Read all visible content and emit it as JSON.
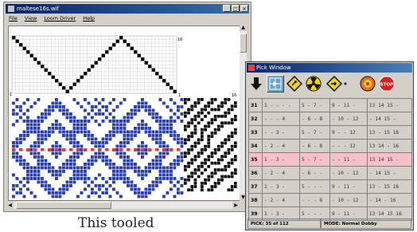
{
  "main_window": {
    "title": "maltese16s.wif",
    "menu": [
      "File",
      "View",
      "Loom Driver",
      "Help"
    ],
    "buttons": {
      "minimize": "_",
      "maximize": "□",
      "close": "×"
    },
    "ticks": {
      "top_right": "16",
      "top_left_mid": "1",
      "row_1": "1",
      "right_16": "16",
      "bottom": "1"
    }
  },
  "pick_window": {
    "title": "Pick Window",
    "tools": [
      "down-arrow-icon",
      "pick-grid-icon",
      "yield-sign-icon",
      "radiation-icon",
      "diamond-pick-icon",
      "bullseye-icon",
      "stop-sign-icon"
    ],
    "stop_label": "STOP",
    "rows": [
      {
        "num": "31",
        "c1": "1 - - - -",
        "c2": "5 - 7 -",
        "c3": "9 - 11 -",
        "c4": "13 14 15 -"
      },
      {
        "num": "32",
        "c1": "- - - 4",
        "c2": "- 6 - 8",
        "c3": "- 10 - 12",
        "c4": "- 14 15 -"
      },
      {
        "num": "33",
        "c1": "- - 3 -",
        "c2": "5 - 7 -",
        "c3": "9 - - 12",
        "c4": "13 - 15 16"
      },
      {
        "num": "34",
        "c1": "- 2 - 4",
        "c2": "- 6 - 8",
        "c3": "- - - 12",
        "c4": "13 14 - 16"
      },
      {
        "num": "35",
        "c1": "1 - 3 -",
        "c2": "5 - 7 -",
        "c3": "- - 11 -",
        "c4": "13 14 15 -"
      },
      {
        "num": "36",
        "c1": "- 2 - 4",
        "c2": "- 6 - -",
        "c3": "- 10 - 12",
        "c4": "- 14 15 -"
      },
      {
        "num": "37",
        "c1": "1 - 3 -",
        "c2": "5 - - -",
        "c3": "9 - 11 -",
        "c4": "13 - 15 16"
      },
      {
        "num": "38",
        "c1": "- 2 - 4",
        "c2": "- - - 8",
        "c3": "- 10 - 12",
        "c4": "- 14 - 16"
      },
      {
        "num": "39",
        "c1": "1 - 3 -",
        "c2": "5 - - -",
        "c3": "9 - 11 -",
        "c4": "13 14 15 16"
      }
    ],
    "selected_row": "35",
    "status": {
      "pick": "PICK: 35 of 112",
      "mode": "MODE: Normal Dobby"
    }
  },
  "caption": "This tooled",
  "colors": {
    "weave_blue": "#2a3fb0",
    "weave_red": "#e03a3a",
    "selection": "#f5c0c8",
    "title_blue": "#0a246a"
  }
}
